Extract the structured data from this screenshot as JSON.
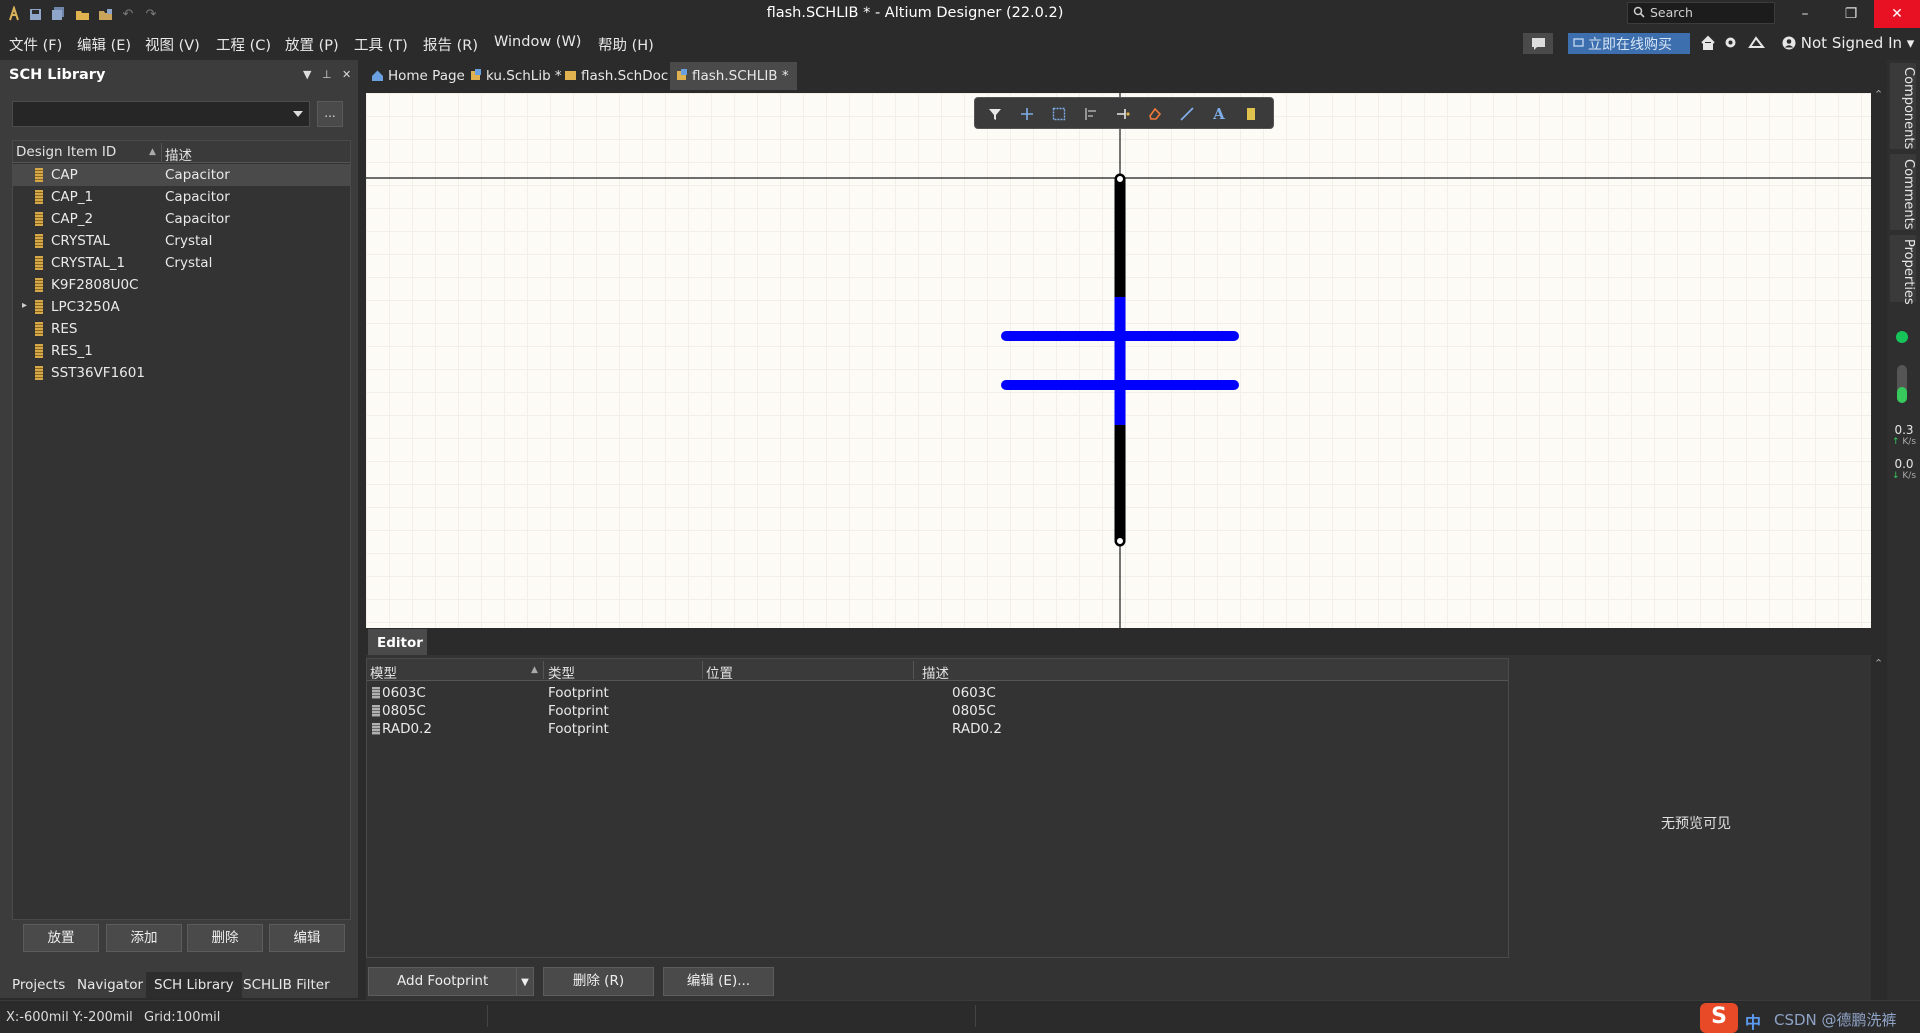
{
  "window": {
    "title": "flash.SCHLIB * - Altium Designer (22.0.2)",
    "search_placeholder": "Search",
    "minimize": "–",
    "restore": "❐",
    "close": "✕"
  },
  "menu": {
    "items": [
      "文件 (F)",
      "编辑 (E)",
      "视图 (V)",
      "工程 (C)",
      "放置 (P)",
      "工具 (T)",
      "报告 (R)",
      "Window (W)",
      "帮助 (H)"
    ],
    "buy_label": "立即在线购买",
    "user_label": "Not Signed In"
  },
  "left_panel": {
    "title": "SCH Library",
    "filter_value": "",
    "browse_label": "...",
    "columns": [
      "Design Item ID",
      "描述"
    ],
    "rows": [
      {
        "id": "CAP",
        "desc": "Capacitor",
        "selected": true
      },
      {
        "id": "CAP_1",
        "desc": "Capacitor"
      },
      {
        "id": "CAP_2",
        "desc": "Capacitor"
      },
      {
        "id": "CRYSTAL",
        "desc": "Crystal"
      },
      {
        "id": "CRYSTAL_1",
        "desc": "Crystal"
      },
      {
        "id": "K9F2808U0C",
        "desc": ""
      },
      {
        "id": "LPC3250A",
        "desc": "",
        "expandable": true
      },
      {
        "id": "RES",
        "desc": ""
      },
      {
        "id": "RES_1",
        "desc": ""
      },
      {
        "id": "SST36VF1601",
        "desc": ""
      }
    ],
    "buttons": [
      "放置",
      "添加",
      "删除",
      "编辑"
    ],
    "tabs": [
      "Projects",
      "Navigator",
      "SCH Library",
      "SCHLIB Filter"
    ],
    "active_tab": "SCH Library"
  },
  "doc_tabs": [
    {
      "label": "Home Page",
      "icon": "home-icon"
    },
    {
      "label": "ku.SchLib *",
      "icon": "schlib-icon"
    },
    {
      "label": "flash.SchDoc",
      "icon": "schdoc-icon"
    },
    {
      "label": "flash.SCHLIB *",
      "icon": "schlib-icon",
      "active": true
    }
  ],
  "toolbar_icons": [
    "filter-icon",
    "add-icon",
    "select-rect-icon",
    "align-icon",
    "pin-icon",
    "eraser-icon",
    "line-icon",
    "text-icon",
    "part-icon"
  ],
  "editor": {
    "tab_label": "Editor",
    "columns": [
      "模型",
      "类型",
      "位置",
      "描述"
    ],
    "rows": [
      {
        "model": "0603C",
        "type": "Footprint",
        "location": "",
        "desc": "0603C"
      },
      {
        "model": "0805C",
        "type": "Footprint",
        "location": "",
        "desc": "0805C"
      },
      {
        "model": "RAD0.2",
        "type": "Footprint",
        "location": "",
        "desc": "RAD0.2"
      }
    ],
    "no_preview": "无预览可见",
    "add_footprint_label": "Add Footprint",
    "delete_label": "删除 (R)",
    "edit_label": "编辑 (E)..."
  },
  "right_panels": {
    "tabs": [
      "Components",
      "Comments",
      "Properties"
    ],
    "upload_value": "0.3",
    "upload_unit": "K/s",
    "download_value": "0.0",
    "download_unit": "K/s"
  },
  "status": {
    "coords": "X:-600mil Y:-200mil",
    "grid": "Grid:100mil",
    "ime": "中",
    "watermark": "CSDN @德鹏洗裤"
  },
  "colors": {
    "accent": "#3d6fae",
    "close": "#e81123",
    "pin": "#000000",
    "body": "#0000ff"
  }
}
